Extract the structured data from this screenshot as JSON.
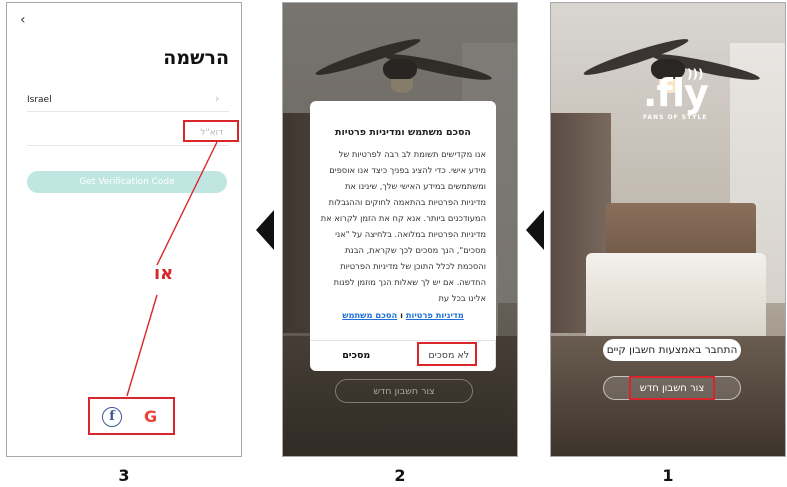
{
  "steps": [
    "1",
    "2",
    "3"
  ],
  "screen1": {
    "logo_text": ".fly",
    "logo_tagline": "FANS OF STYLE",
    "login_button": "התחבר באמצעות חשבון קיים",
    "register_button": "צור חשבון חדש"
  },
  "screen2": {
    "dialog_title": "הסכם משתמש ומדיניות פרטיות",
    "dialog_body": "אנו מקדישים תשומת לב רבה לפרטיות של מידע אישי. כדי להציג בפניך כיצד אנו אוספים ומשתמשים במידע האישי שלך, שינינו את מדיניות הפרטיות בהתאמה לחוקים וההגבלות המעודכנים ביותר. אנא קח את הזמן לקרוא את מדיניות הפרטיות במלואה. בלחיצה על \"אני מסכים\", הנך מסכים לכך שקראת, הבנת והסכמת לכלל התוכן של מדיניות הפרטיות החדשה. אם יש לך שאלות הנך מוזמן לפנות אלינו בכל עת",
    "link_privacy": "מדיניות פרטיות",
    "link_separator": "ו",
    "link_terms": "הסכם משתמש",
    "accept_button": "מסכים",
    "decline_button": "לא מסכים",
    "background_button": "צור חשבון חדש"
  },
  "screen3": {
    "back_icon": "‹",
    "title": "הרשמה",
    "country_value": "Israel",
    "email_placeholder": "דוא\"ל",
    "verify_button": "Get Verification Code",
    "or_label": "או",
    "facebook_icon_glyph": "f",
    "google_icon_glyph": "G"
  },
  "colors": {
    "highlight": "#d9262b",
    "verify_button_bg": "#bfe6e0",
    "link": "#1f6fd6"
  }
}
